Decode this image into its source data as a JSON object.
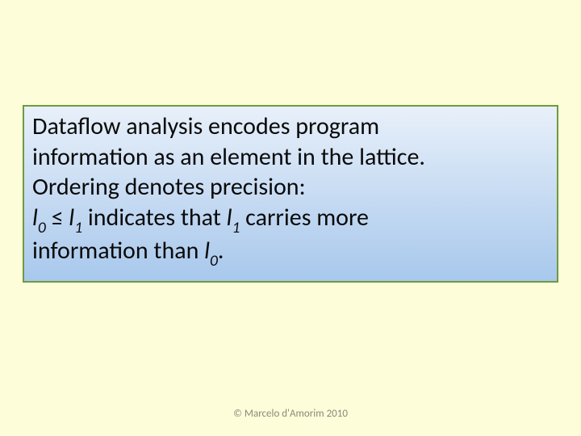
{
  "slide": {
    "text": {
      "line1": "Dataflow analysis encodes program",
      "line2": "information as an element in the lattice.",
      "line3a": "Ordering denotes precision:",
      "l": "l",
      "sub0": "0",
      "sub1": "1",
      "leq": " ≤ ",
      "ind_a": " indicates that ",
      "ind_b": " carries more",
      "line5a": "information than ",
      "period": "."
    },
    "footer": "© Marcelo d'Amorim 2010"
  }
}
